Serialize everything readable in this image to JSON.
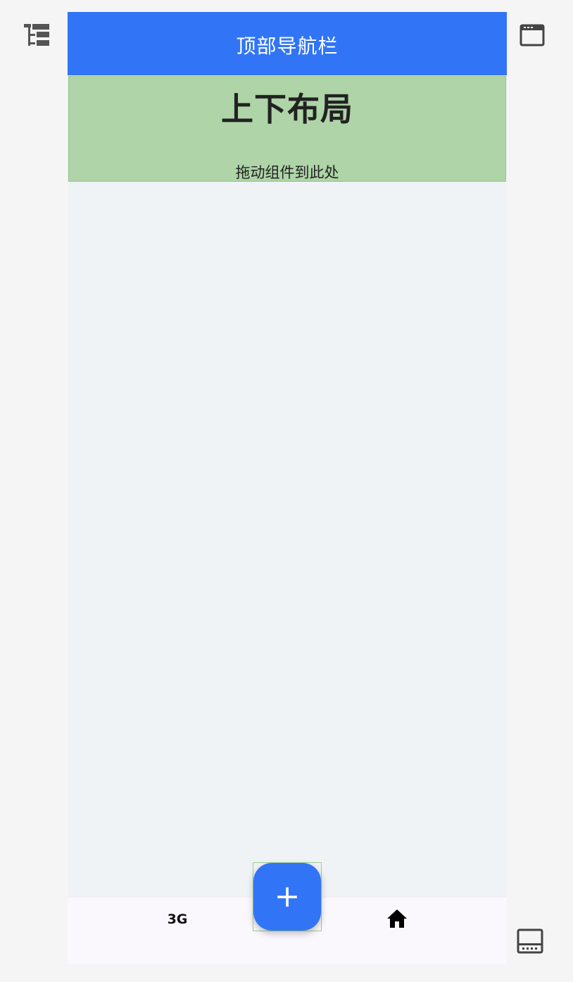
{
  "top_nav": {
    "title": "顶部导航栏"
  },
  "layout_block": {
    "title": "上下布局",
    "hint": "拖动组件到此处"
  },
  "bottom_bar": {
    "tab_left_label": "3G",
    "tab_right_icon": "home-icon"
  },
  "fab": {
    "label": "+"
  },
  "side_icons": [
    "tree-view-icon",
    "browser-window-icon",
    "bottom-panel-icon"
  ],
  "colors": {
    "accent": "#3175f6",
    "layout_block_bg": "#aed4a7",
    "canvas_bg": "#eff3f6",
    "page_bg": "#f5f5f5"
  }
}
